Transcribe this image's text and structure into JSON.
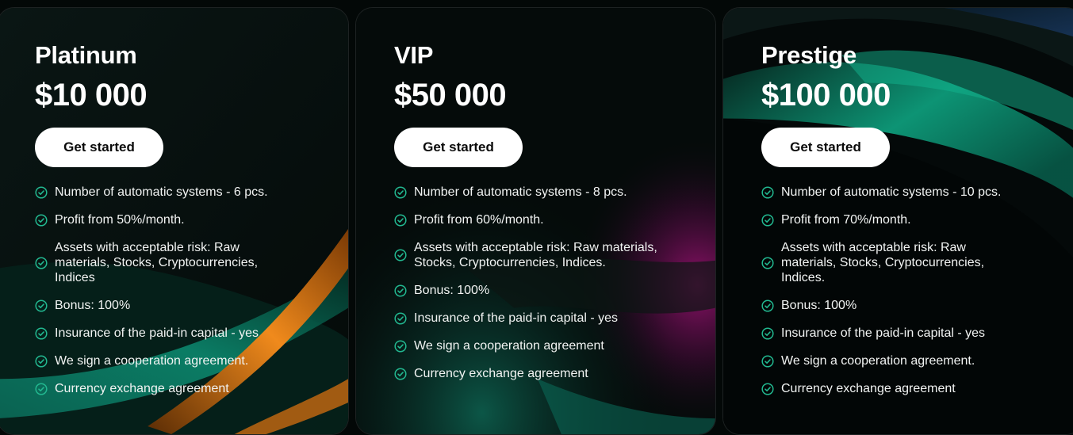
{
  "colors": {
    "background": "#030807",
    "card_border": "rgba(255,255,255,0.10)",
    "check_color": "#22b890",
    "button_bg": "#ffffff",
    "button_text": "#0b0b0b",
    "accent_teal": "#0ea380",
    "accent_orange": "#f08a1c",
    "accent_magenta": "#c0148c"
  },
  "plans": [
    {
      "title": "Platinum",
      "price": "$10 000",
      "button_label": "Get started",
      "check_icon": "check-circle-icon",
      "features": [
        "Number of automatic systems - 6 pcs.",
        "Profit from 50%/month.",
        "Assets with acceptable risk: Raw materials, Stocks, Cryptocurrencies, Indices",
        "Bonus: 100%",
        "Insurance of the paid-in capital - yes",
        "We sign a cooperation agreement.",
        "Currency exchange agreement"
      ]
    },
    {
      "title": "VIP",
      "price": "$50 000",
      "button_label": "Get started",
      "check_icon": "check-circle-icon",
      "features": [
        "Number of automatic systems - 8 pcs.",
        "Profit from 60%/month.",
        "Assets with acceptable risk: Raw materials, Stocks, Cryptocurrencies, Indices.",
        "Bonus: 100%",
        "Insurance of the paid-in capital - yes",
        "We sign a cooperation agreement",
        "Currency exchange agreement"
      ]
    },
    {
      "title": "Prestige",
      "price": "$100 000",
      "button_label": "Get started",
      "check_icon": "check-circle-icon",
      "features": [
        "Number of automatic systems - 10 pcs.",
        "Profit from 70%/month.",
        "Assets with acceptable risk: Raw materials, Stocks, Cryptocurrencies, Indices.",
        "Bonus: 100%",
        "Insurance of the paid-in capital - yes",
        "We sign a cooperation agreement.",
        "Currency exchange agreement"
      ]
    }
  ]
}
